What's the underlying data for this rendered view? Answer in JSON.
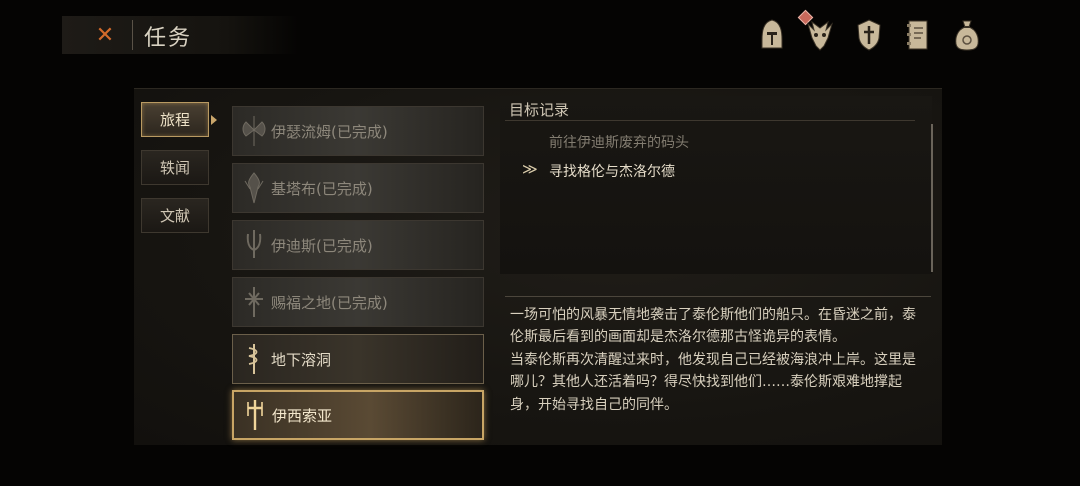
{
  "header": {
    "close_icon": "close-icon",
    "title": "任务",
    "icons": [
      "knight-helmet-icon",
      "beast-skull-icon",
      "shield-icon",
      "journal-icon",
      "coin-bag-icon"
    ]
  },
  "side_tabs": [
    {
      "label": "旅程",
      "active": true
    },
    {
      "label": "轶闻",
      "active": false
    },
    {
      "label": "文献",
      "active": false
    }
  ],
  "quests": [
    {
      "label": "伊瑟流姆(已完成)",
      "state": "done",
      "icon": "axe-emblem-icon"
    },
    {
      "label": "基塔布(已完成)",
      "state": "done",
      "icon": "flame-emblem-icon"
    },
    {
      "label": "伊迪斯(已完成)",
      "state": "done",
      "icon": "blade-emblem-icon"
    },
    {
      "label": "赐福之地(已完成)",
      "state": "done",
      "icon": "cross-emblem-icon"
    },
    {
      "label": "地下溶洞",
      "state": "open",
      "icon": "serpent-staff-icon"
    },
    {
      "label": "伊西索亚",
      "state": "selected",
      "icon": "sword-emblem-icon"
    }
  ],
  "objectives": {
    "title": "目标记录",
    "items": [
      {
        "text": "前往伊迪斯废弃的码头",
        "status": "done"
      },
      {
        "text": "寻找格伦与杰洛尔德",
        "status": "current",
        "marker": "≫"
      }
    ]
  },
  "description": {
    "para1": "一场可怕的风暴无情地袭击了泰伦斯他们的船只。在昏迷之前，泰伦斯最后看到的画面却是杰洛尔德那古怪诡异的表情。",
    "para2": "当泰伦斯再次清醒过来时，他发现自己已经被海浪冲上岸。这里是哪儿？其他人还活着吗？得尽快找到他们……泰伦斯艰难地撑起身，开始寻找自己的同伴。"
  },
  "colors": {
    "accent": "#c8a565",
    "close": "#d46a2a",
    "badge": "#c9695b"
  }
}
